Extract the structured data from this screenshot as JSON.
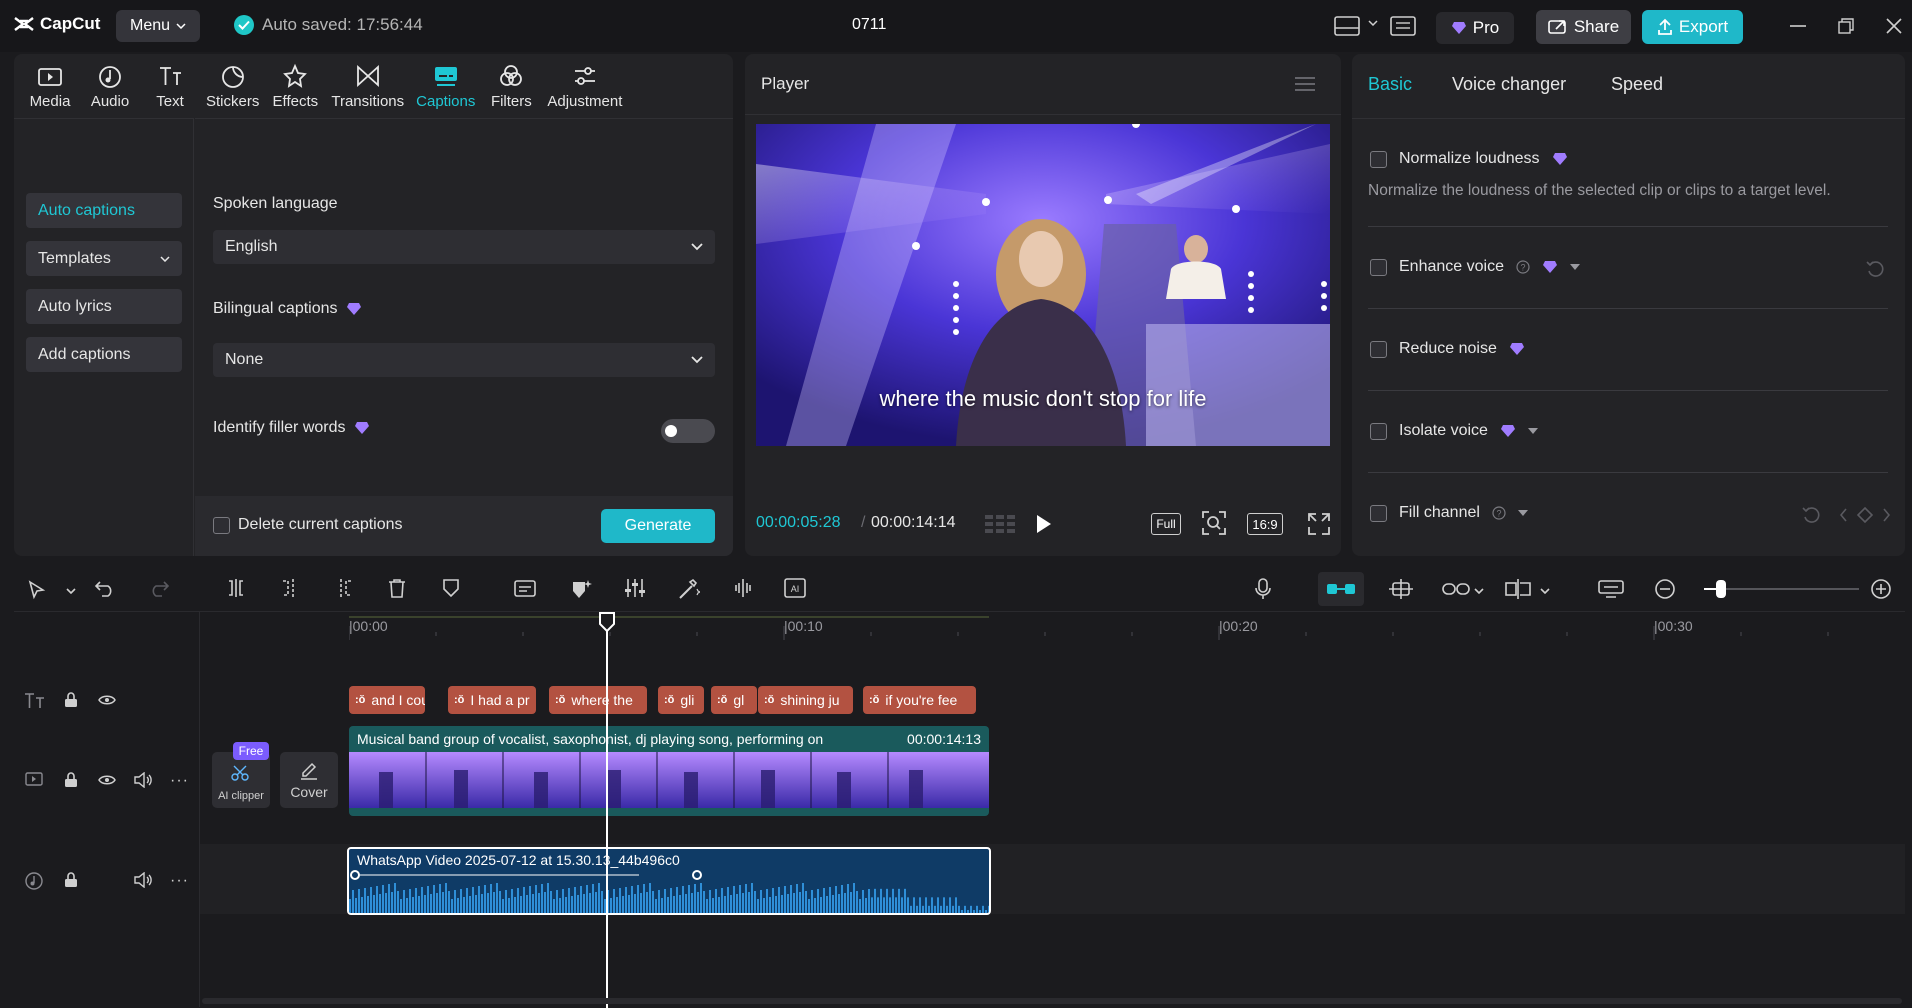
{
  "app": {
    "name": "CapCut",
    "menu_label": "Menu",
    "autosave": "Auto saved: 17:56:44",
    "project_title": "0711",
    "pro_label": "Pro",
    "share_label": "Share",
    "export_label": "Export"
  },
  "tabs": [
    "Media",
    "Audio",
    "Text",
    "Stickers",
    "Effects",
    "Transitions",
    "Captions",
    "Filters",
    "Adjustment"
  ],
  "active_tab": "Captions",
  "sidebar": [
    "Auto captions",
    "Templates",
    "Auto lyrics",
    "Add captions"
  ],
  "captions": {
    "spoken_language_label": "Spoken language",
    "spoken_language_value": "English",
    "bilingual_label": "Bilingual captions",
    "bilingual_value": "None",
    "filler_label": "Identify filler words",
    "delete_label": "Delete current captions",
    "generate_label": "Generate"
  },
  "player": {
    "title": "Player",
    "subtitle": "where the music don't stop for life",
    "current_time": "00:00:05:28",
    "total_time": "00:00:14:14",
    "full_label": "Full",
    "ratio_label": "16:9"
  },
  "right": {
    "tabs": [
      "Basic",
      "Voice changer",
      "Speed"
    ],
    "normalize_label": "Normalize loudness",
    "normalize_desc": "Normalize the loudness of the selected clip or clips to a target level.",
    "enhance_label": "Enhance voice",
    "reduce_label": "Reduce noise",
    "isolate_label": "Isolate voice",
    "fill_label": "Fill channel"
  },
  "timeline": {
    "ruler": [
      "|00:00",
      "|00:10",
      "|00:20",
      "|00:30"
    ],
    "caption_clips": [
      "and I cou",
      "I had a pr",
      "where the",
      "gli",
      "gl",
      "shining ju",
      "if you're fee"
    ],
    "video_clip_title": "Musical band group of vocalist, saxophonist, dj playing song, performing on",
    "video_clip_duration": "00:00:14:13",
    "audio_clip_title": "WhatsApp Video 2025-07-12 at 15.30.13_44b496c0",
    "free_badge": "Free",
    "ai_clipper_label": "AI clipper",
    "cover_label": "Cover"
  }
}
